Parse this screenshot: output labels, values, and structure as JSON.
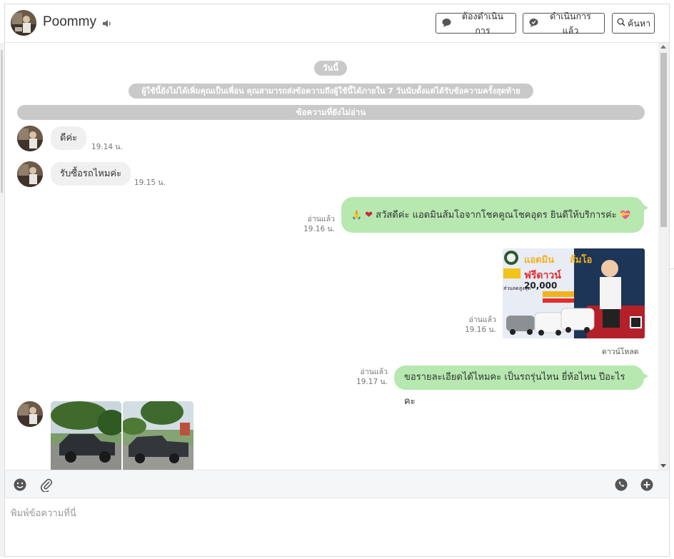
{
  "header": {
    "contact_name": "Poommy",
    "buttons": {
      "todo": "ต้องดำเนินการ",
      "done": "ดำเนินการแล้ว",
      "search": "ค้นหา"
    }
  },
  "chat": {
    "day_label": "วันนี้",
    "notice": "ผู้ใช้นี้ยังไม่ได้เพิ่มคุณเป็นเพื่อน คุณสามารถส่งข้อความถึงผู้ใช้นี้ได้ภายใน 7 วันนับตั้งแต่ได้รับข้อความครั้งสุดท้าย",
    "unread_label": "ข้อความที่ยังไม่อ่าน",
    "messages": [
      {
        "direction": "in",
        "text": "ดีค่ะ",
        "time": "19.14 น."
      },
      {
        "direction": "in",
        "text": "รับซื้อรถไหมค่ะ",
        "time": "19.15 น."
      },
      {
        "direction": "out",
        "text": "สวัสดีค่ะ แอดมินส้มโอจากโชคคูณโชคอุดร ยินดีให้บริการค่ะ",
        "read": "อ่านแล้ว",
        "time": "19.16 น."
      },
      {
        "direction": "out",
        "type": "image",
        "read": "อ่านแล้ว",
        "time": "19.16 น.",
        "download": "ดาวน์โหลด",
        "image_text": {
          "admin": "แอดมิน",
          "name": "ส้มโอ",
          "free_down": "ฟรีดาวน์",
          "discount": "20,000",
          "prefix": "ส่วนลดสูงสุด"
        }
      },
      {
        "direction": "out",
        "text": "ขอรายละเอียดได้ไหมคะ เป็นรถรุ่นไหน ยี่ห้อไหน ปีอะไรคะ",
        "read": "อ่านแล้ว",
        "time": "19.17 น."
      }
    ]
  },
  "composer": {
    "placeholder": "พิมพ์ข้อความที่นี่",
    "icons": [
      "emoji-icon",
      "attachment-icon",
      "sticker-icon",
      "add-icon"
    ]
  },
  "colors": {
    "outgoing_bubble": "#b6e8b0",
    "incoming_bubble": "#f0f0f0",
    "pill": "#c9c9c9"
  }
}
